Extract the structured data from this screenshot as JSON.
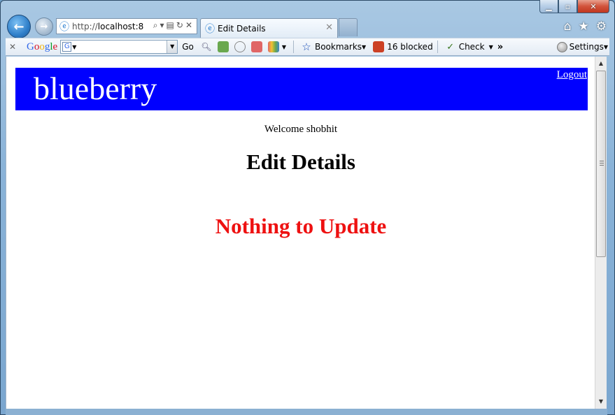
{
  "browser": {
    "address_prefix": "http://",
    "address_host": "localhost:8",
    "tab_title": "Edit Details"
  },
  "toolbar": {
    "google_logo": [
      "G",
      "o",
      "o",
      "g",
      "l",
      "e"
    ],
    "search_box_icon": "G",
    "go_label": "Go",
    "bookmarks_label": "Bookmarks",
    "blocked_label": "16 blocked",
    "check_label": "Check",
    "more_label": "»",
    "settings_label": "Settings"
  },
  "page": {
    "brand": "blueberry",
    "logout_label": "Logout",
    "welcome_text": "Welcome shobhit",
    "title": "Edit Details",
    "message": "Nothing to Update"
  },
  "colors": {
    "banner": "#0000ff",
    "message": "#ee1111"
  }
}
